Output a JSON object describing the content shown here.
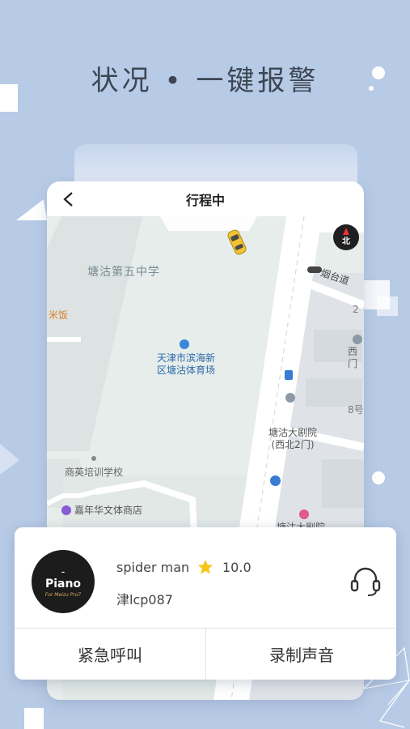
{
  "headline": "状况 • 一键报警",
  "nav": {
    "title": "行程中",
    "back_icon": "chevron-left-icon"
  },
  "map": {
    "labels": {
      "school": "塘沽第五中学",
      "restaurant": "米饭",
      "stadium": "天津市滨海新区塘沽体育场",
      "road": "烟台道",
      "num2": "2",
      "west_gate": "西门",
      "num8": "8号",
      "theater1": "塘沽大剧院(西北2门)",
      "training": "商英培训学校",
      "store": "嘉年华文体商店",
      "theater2": "塘沽大剧院"
    },
    "compass_label": "北"
  },
  "driver": {
    "avatar_line1": "-",
    "avatar_line2": "Piano",
    "avatar_line3": "For Meizu Pro7",
    "name": "spider man",
    "rating": "10.0",
    "plate": "津lcp087",
    "support_icon": "headset-icon"
  },
  "actions": {
    "emergency": "紧急呼叫",
    "record": "录制声音"
  },
  "colors": {
    "background": "#b8cbe6",
    "map": "#e6edeb",
    "star": "#f5c518",
    "taxi": "#f2c230"
  }
}
